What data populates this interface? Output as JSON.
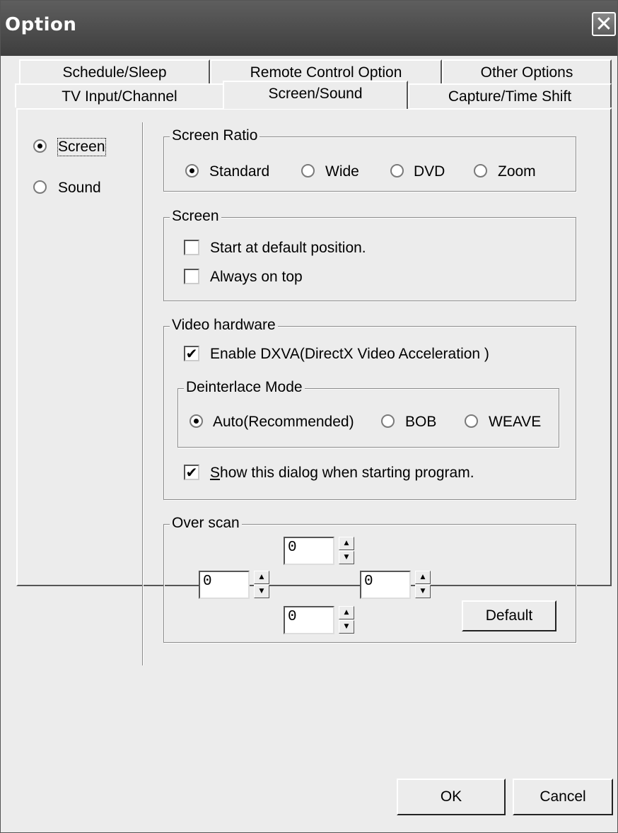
{
  "window": {
    "title": "Option",
    "close_glyph": "✕"
  },
  "tabs": {
    "row_back": [
      {
        "label": "Schedule/Sleep"
      },
      {
        "label": "Remote Control Option"
      },
      {
        "label": "Other Options"
      }
    ],
    "row_front": [
      {
        "label": "TV Input/Channel"
      },
      {
        "label": "Screen/Sound",
        "selected": true
      },
      {
        "label": "Capture/Time Shift"
      }
    ]
  },
  "sidebar": {
    "items": [
      {
        "label": "Screen",
        "selected": true
      },
      {
        "label": "Sound",
        "selected": false
      }
    ]
  },
  "screen_ratio": {
    "legend": "Screen Ratio",
    "options": [
      {
        "label": "Standard",
        "selected": true
      },
      {
        "label": "Wide",
        "selected": false
      },
      {
        "label": "DVD",
        "selected": false
      },
      {
        "label": "Zoom",
        "selected": false
      }
    ]
  },
  "screen": {
    "legend": "Screen",
    "start_default_position": {
      "label": "Start at default position.",
      "checked": false
    },
    "always_on_top": {
      "label": "Always on top",
      "checked": false
    }
  },
  "video_hardware": {
    "legend": "Video hardware",
    "enable_dxva": {
      "label": "Enable DXVA(DirectX Video Acceleration )",
      "checked": true
    },
    "deinterlace": {
      "legend": "Deinterlace Mode",
      "options": [
        {
          "label": "Auto(Recommended)",
          "selected": true
        },
        {
          "label": "BOB",
          "selected": false
        },
        {
          "label": "WEAVE",
          "selected": false
        }
      ]
    },
    "show_dialog": {
      "label_prefix": "S",
      "label_rest": "how this dialog when starting program.",
      "checked": true
    }
  },
  "over_scan": {
    "legend": "Over scan",
    "top": "0",
    "left": "0",
    "right": "0",
    "bottom": "0",
    "default_label": "Default"
  },
  "footer": {
    "ok_label": "OK",
    "cancel_label": "Cancel"
  },
  "icons": {
    "check": "✔",
    "spin_up": "▲",
    "spin_down": "▼"
  },
  "colors": {
    "titlebar": "#4a4a4a",
    "dialog_bg": "#ececec"
  }
}
